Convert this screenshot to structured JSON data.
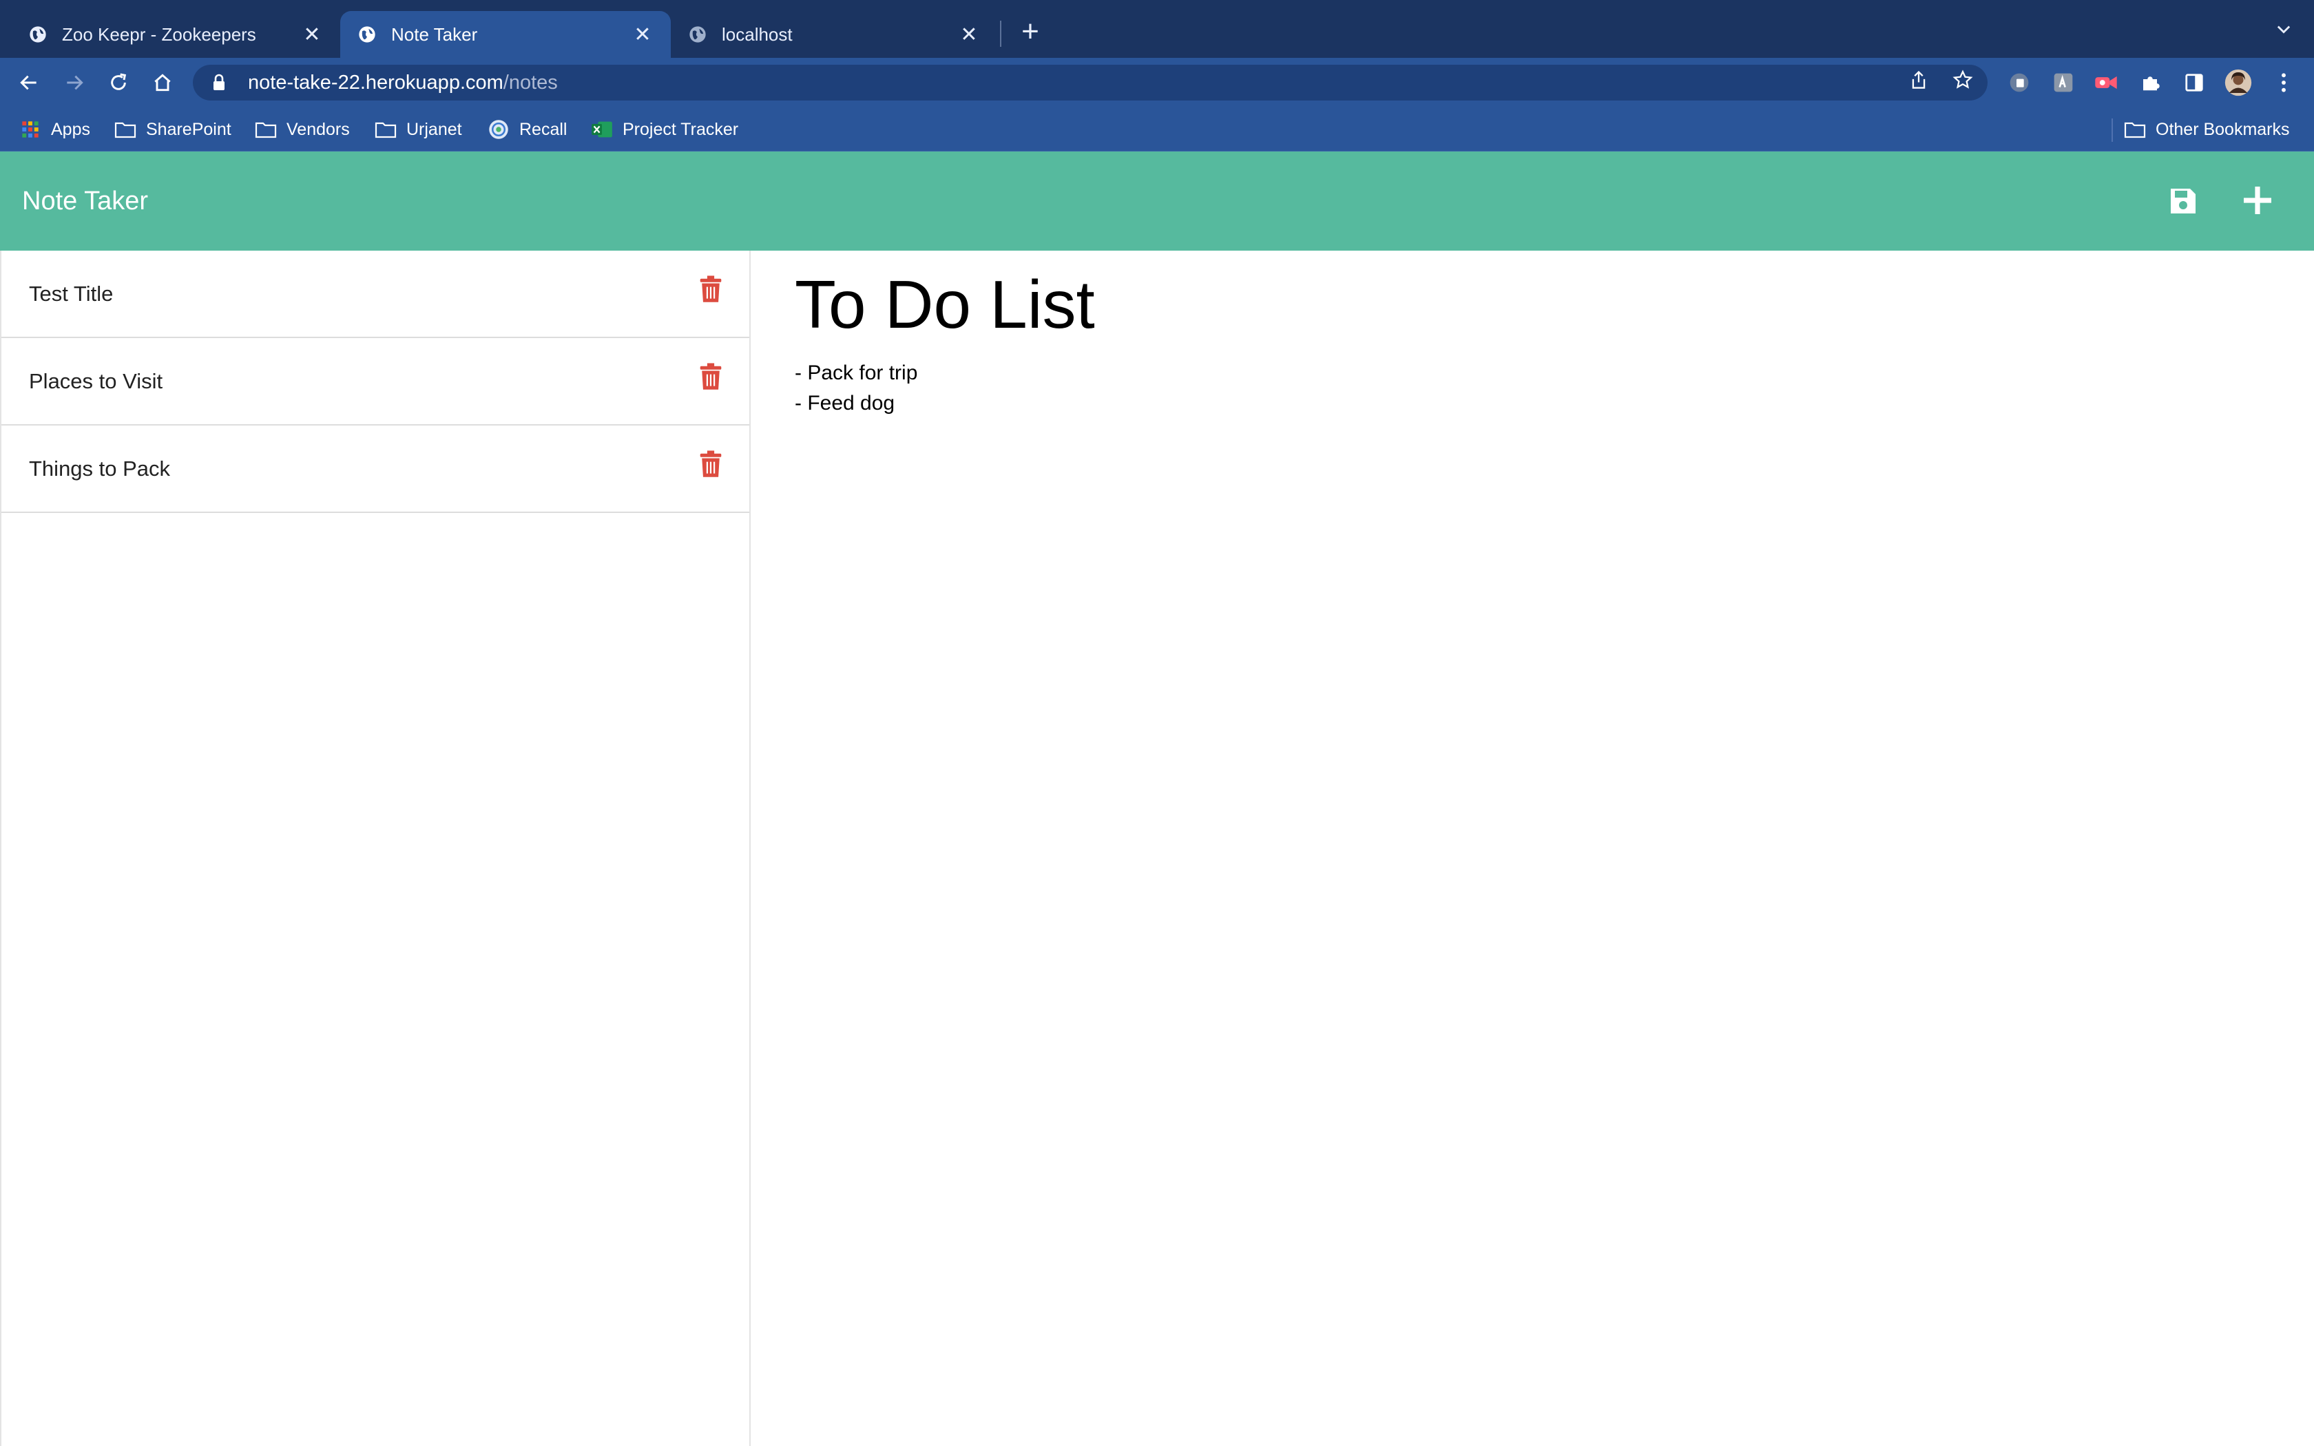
{
  "browser": {
    "tabs": [
      {
        "title": "Zoo Keepr - Zookeepers",
        "favicon": "globe-icon",
        "active": false
      },
      {
        "title": "Note Taker",
        "favicon": "globe-icon",
        "active": true
      },
      {
        "title": "localhost",
        "favicon": "globe-icon",
        "active": false
      }
    ],
    "address": {
      "host": "note-take-22.herokuapp.com",
      "path": "/notes"
    },
    "bookmarks": [
      {
        "label": "Apps",
        "icon": "apps-grid-icon"
      },
      {
        "label": "SharePoint",
        "icon": "folder-icon"
      },
      {
        "label": "Vendors",
        "icon": "folder-icon"
      },
      {
        "label": "Urjanet",
        "icon": "folder-icon"
      },
      {
        "label": "Recall",
        "icon": "recall-icon"
      },
      {
        "label": "Project Tracker",
        "icon": "excel-icon"
      }
    ],
    "other_bookmarks": "Other Bookmarks"
  },
  "app": {
    "title": "Note Taker",
    "accent_color": "#56ba9e",
    "delete_color": "#dc4b3f"
  },
  "notes": [
    {
      "title": "Test Title"
    },
    {
      "title": "Places to Visit"
    },
    {
      "title": "Things to Pack"
    }
  ],
  "active_note": {
    "title": "To Do List",
    "text": "- Pack for trip\n- Feed dog"
  }
}
